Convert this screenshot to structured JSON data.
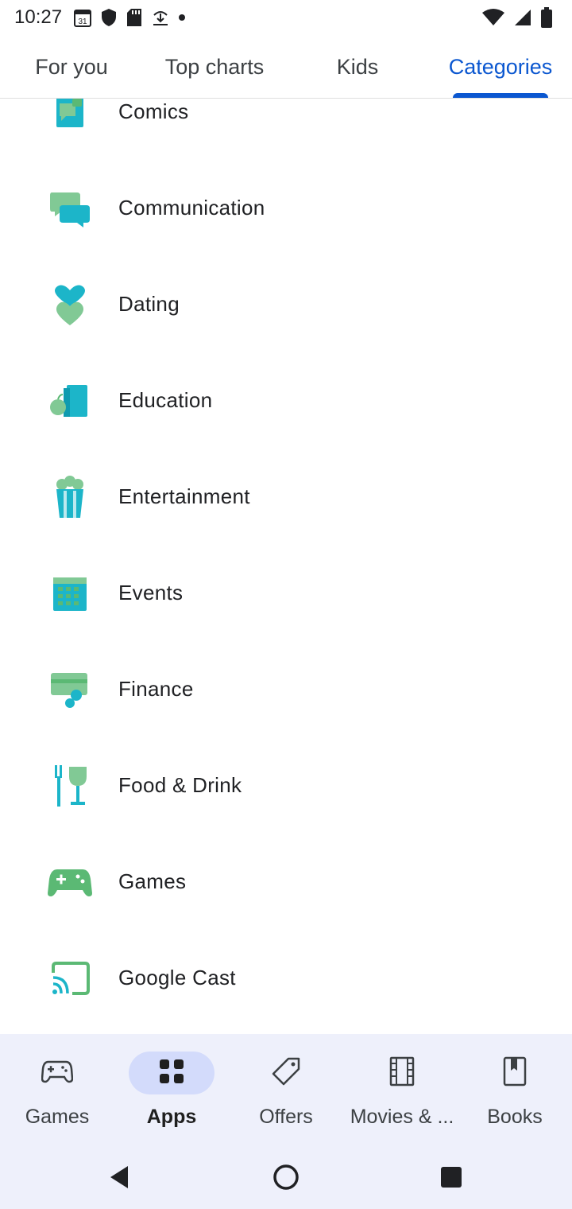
{
  "status_bar": {
    "time": "10:27",
    "left_icons": [
      "calendar-icon",
      "shield-icon",
      "sd-card-icon",
      "download-tray-icon",
      "dot-icon"
    ],
    "right_icons": [
      "wifi-icon",
      "signal-icon",
      "battery-icon"
    ]
  },
  "top_tabs": [
    {
      "label": "For you",
      "active": false
    },
    {
      "label": "Top charts",
      "active": false
    },
    {
      "label": "Kids",
      "active": false
    },
    {
      "label": "Categories",
      "active": true
    }
  ],
  "categories": [
    {
      "label": "Comics",
      "icon": "comics-icon"
    },
    {
      "label": "Communication",
      "icon": "communication-icon"
    },
    {
      "label": "Dating",
      "icon": "dating-icon"
    },
    {
      "label": "Education",
      "icon": "education-icon"
    },
    {
      "label": "Entertainment",
      "icon": "entertainment-icon"
    },
    {
      "label": "Events",
      "icon": "events-icon"
    },
    {
      "label": "Finance",
      "icon": "finance-icon"
    },
    {
      "label": "Food & Drink",
      "icon": "food-drink-icon"
    },
    {
      "label": "Games",
      "icon": "games-icon"
    },
    {
      "label": "Google Cast",
      "icon": "google-cast-icon"
    }
  ],
  "bottom_nav": [
    {
      "label": "Games",
      "icon": "gamepad-icon",
      "active": false
    },
    {
      "label": "Apps",
      "icon": "apps-grid-icon",
      "active": true
    },
    {
      "label": "Offers",
      "icon": "tag-icon",
      "active": false
    },
    {
      "label": "Movies & ...",
      "icon": "film-icon",
      "active": false
    },
    {
      "label": "Books",
      "icon": "bookmark-book-icon",
      "active": false
    }
  ],
  "colors": {
    "accent": "#0b57d0",
    "nav_background": "#eef0fb",
    "nav_active_pill": "#d3dbfb",
    "icon_green": "#5bb974",
    "icon_teal": "#1cb5c9",
    "icon_light_green": "#81c995"
  }
}
